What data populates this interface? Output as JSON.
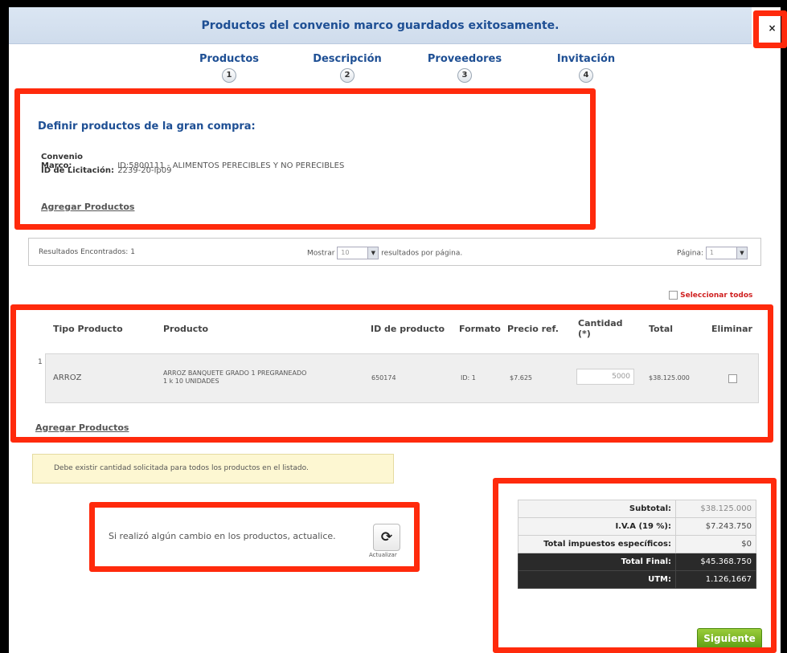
{
  "banner": {
    "message": "Productos del convenio marco guardados exitosamente.",
    "close": "×"
  },
  "steps": [
    {
      "label": "Productos",
      "num": "1"
    },
    {
      "label": "Descripción",
      "num": "2"
    },
    {
      "label": "Proveedores",
      "num": "3"
    },
    {
      "label": "Invitación",
      "num": "4"
    }
  ],
  "definition": {
    "title": "Definir productos de la gran compra:",
    "convenio_label": "Convenio Marco:",
    "convenio_value": "ID:5800111 - ALIMENTOS PERECIBLES Y NO PERECIBLES",
    "licitacion_label": "ID de Licitación:",
    "licitacion_value": "2239-20-lp09",
    "add_link": "Agregar Productos"
  },
  "results": {
    "found": "Resultados Encontrados: 1",
    "show_label": "Mostrar",
    "show_value": "10",
    "per_page": "resultados por página.",
    "page_label": "Página:",
    "page_value": "1"
  },
  "select_all": "Seleccionar todos",
  "table": {
    "headers": {
      "tipo": "Tipo Producto",
      "producto": "Producto",
      "id": "ID de producto",
      "formato": "Formato",
      "precio": "Precio ref.",
      "cantidad_1": "Cantidad",
      "cantidad_2": "(*)",
      "total": "Total",
      "eliminar": "Eliminar"
    },
    "rows": [
      {
        "index": "1",
        "tipo": "ARROZ",
        "producto_1": "ARROZ BANQUETE GRADO 1 PREGRANEADO",
        "producto_2": "1 k 10 UNIDADES",
        "id": "650174",
        "formato": "ID: 1",
        "precio": "$7.625",
        "cantidad": "5000",
        "total": "$38.125.000"
      }
    ],
    "add_link": "Agregar Productos"
  },
  "warning": "Debe existir cantidad solicitada para todos los productos en el listado.",
  "update": {
    "text": "Si realizó algún cambio en los productos, actualice.",
    "button_label": "Actualizar",
    "icon": "refresh-icon"
  },
  "totals": {
    "subtotal_label": "Subtotal:",
    "subtotal": "$38.125.000",
    "iva_label": "I.V.A (19 %):",
    "iva": "$7.243.750",
    "impuestos_label": "Total impuestos específicos:",
    "impuestos": "$0",
    "final_label": "Total Final:",
    "final": "$45.368.750",
    "utm_label": "UTM:",
    "utm": "1.126,1667"
  },
  "next_button": "Siguiente",
  "colors": {
    "highlight": "#ff2a0c",
    "accent": "#1e4f94",
    "next": "#6aaa1a"
  }
}
